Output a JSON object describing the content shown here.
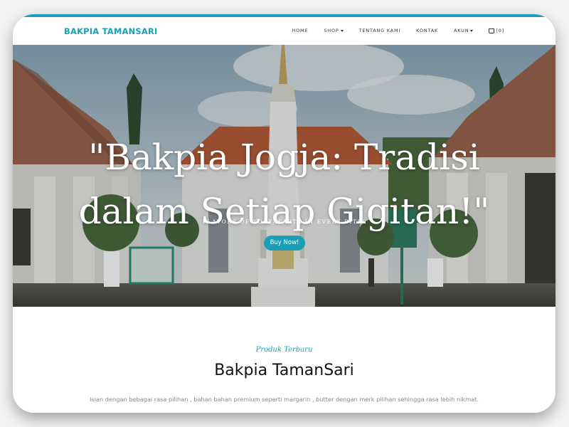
{
  "nav": {
    "brand": "BAKPIA TAMANSARI",
    "items": [
      {
        "label": "HOME"
      },
      {
        "label": "SHOP"
      },
      {
        "label": "TENTANG KAMI"
      },
      {
        "label": "KONTAK"
      },
      {
        "label": "AKUN"
      }
    ],
    "cart_label": "[0]"
  },
  "hero": {
    "heading": "\"Bakpia Jogja: Tradisi dalam Setiap Gigitan!\"",
    "subheading": "FLAVORS OF YOGYAKARTA IN EVERY BITE!",
    "cta_label": "Buy Now!"
  },
  "products": {
    "subtitle": "Produk Terbaru",
    "title": "Bakpia TamanSari",
    "description": "Isian dengan bebagai rasa pilihan , bahan bahan premium seperti margarin , butter dengan merk pilihan sehingga rasa lebih nikmat."
  },
  "colors": {
    "accent": "#1a9fb8"
  },
  "icons": {
    "cart": "cart-icon",
    "dropdown": "caret-down-icon"
  }
}
